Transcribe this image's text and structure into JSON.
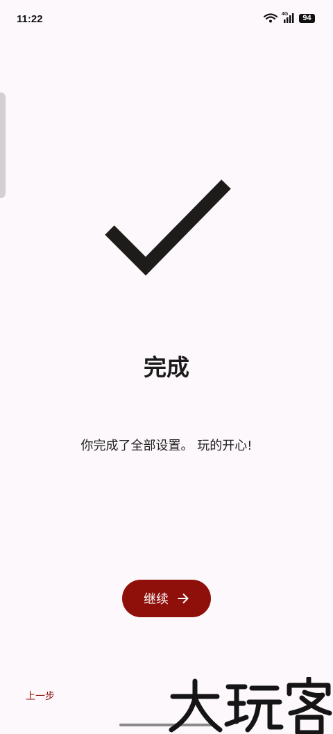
{
  "status_bar": {
    "time": "11:22",
    "network": "4G",
    "battery": "94"
  },
  "main": {
    "title": "完成",
    "message": "你完成了全部设置。 玩的开心!"
  },
  "actions": {
    "continue_label": "继续",
    "back_label": "上一步"
  },
  "watermark": {
    "text": "大玩客"
  },
  "icons": {
    "main": "checkmark-icon",
    "continue": "arrow-right-icon",
    "status": [
      "wifi-icon",
      "cellular-signal-icon",
      "battery-icon"
    ]
  },
  "colors": {
    "background": "#fdf8fb",
    "accent": "#8f0f0b",
    "text": "#1b1b1b"
  }
}
